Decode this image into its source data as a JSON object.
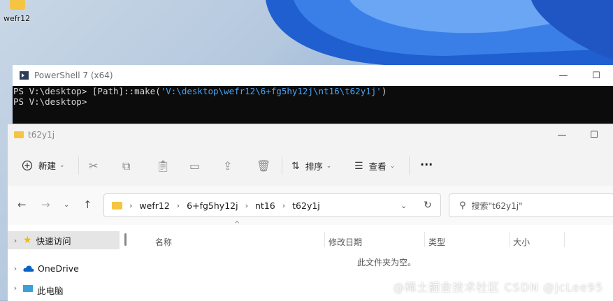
{
  "desktop": {
    "icon_label": "wefr12"
  },
  "powershell": {
    "title": "PowerShell 7 (x64)",
    "prompt1": "PS V:\\desktop> ",
    "command_prefix": "[Path]::make(",
    "command_path": "'V:\\desktop\\wefr12\\6+fg5hy12j\\nt16\\t62y1j'",
    "command_suffix": ")",
    "prompt2": "PS V:\\desktop>",
    "minimize_glyph": "—",
    "maximize_glyph": "☐"
  },
  "explorer": {
    "title": "t62y1j",
    "toolbar": {
      "new_label": "新建",
      "sort_label": "排序",
      "view_label": "查看",
      "more_glyph": "···"
    },
    "breadcrumb": [
      "wefr12",
      "6+fg5hy12j",
      "nt16",
      "t62y1j"
    ],
    "search_placeholder": "搜索\"t62y1j\"",
    "columns": [
      "名称",
      "修改日期",
      "类型",
      "大小"
    ],
    "empty_message": "此文件夹为空。",
    "sidebar": [
      {
        "label": "快速访问",
        "icon": "star-icon",
        "selected": true
      },
      {
        "label": "OneDrive",
        "icon": "cloud-icon",
        "selected": false
      },
      {
        "label": "此电脑",
        "icon": "computer-icon",
        "selected": false
      }
    ]
  },
  "watermark": "@稀土掘金技术社区  CSDN @jcLee95",
  "colors": {
    "accent": "#0067c0",
    "folder": "#f5c542",
    "ps_path": "#4aa3f0",
    "console_bg": "#0c0c0c"
  }
}
